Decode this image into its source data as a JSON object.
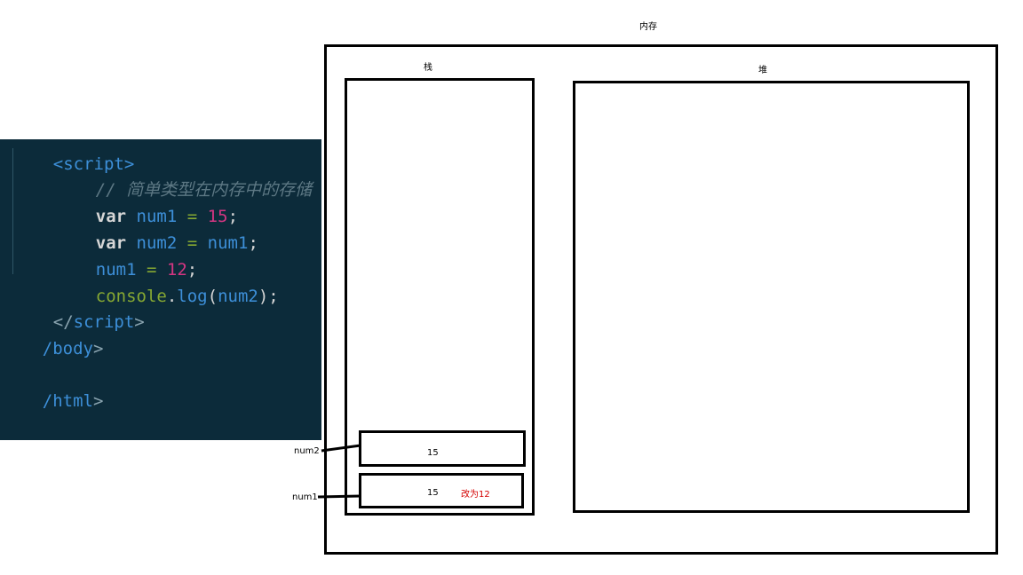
{
  "code": {
    "lines": [
      [
        "<script>"
      ],
      [
        "// 简单类型在内存中的存储"
      ],
      [
        "var",
        "num1",
        "=",
        "15",
        ";"
      ],
      [
        "var",
        "num2",
        "=",
        "num1",
        ";"
      ],
      [
        "num1",
        "=",
        "12",
        ";"
      ],
      [
        "console",
        ".",
        "log",
        "(",
        "num2",
        ")",
        ";"
      ],
      [
        "</",
        "script",
        ">"
      ],
      [
        "/",
        "body",
        ">"
      ],
      [
        "/",
        "html",
        ">"
      ]
    ]
  },
  "diagram": {
    "memory_label": "内存",
    "stack_label": "栈",
    "heap_label": "堆",
    "num2_label": "num2",
    "num1_label": "num1",
    "num2_value": "15",
    "num1_value": "15",
    "num1_note": "改为12"
  }
}
